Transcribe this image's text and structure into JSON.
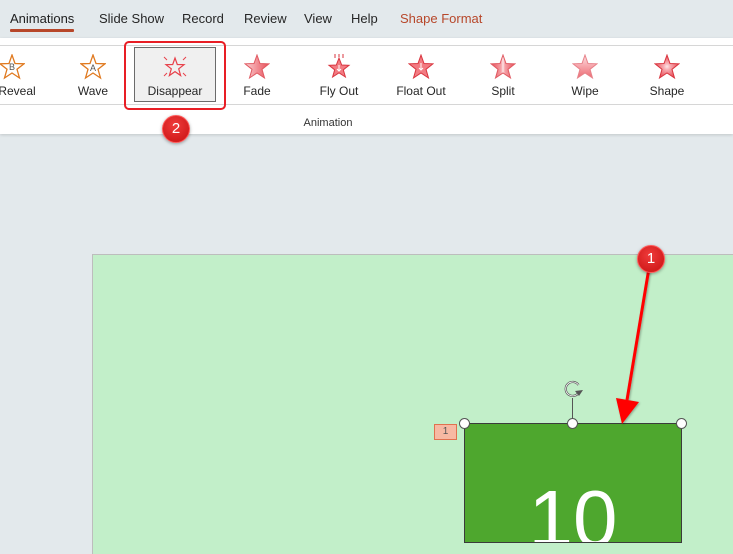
{
  "tabs": [
    {
      "label": "Animations",
      "active": true
    },
    {
      "label": "Slide Show"
    },
    {
      "label": "Record"
    },
    {
      "label": "Review"
    },
    {
      "label": "View"
    },
    {
      "label": "Help"
    },
    {
      "label": "Shape Format",
      "contextual": true
    }
  ],
  "ribbon": {
    "gallery": [
      {
        "label": "d Reveal",
        "icon": "star-b-outline-icon"
      },
      {
        "label": "Wave",
        "icon": "star-a-outline-icon"
      },
      {
        "label": "Disappear",
        "icon": "star-burst-outline-icon",
        "selected": true
      },
      {
        "label": "Fade",
        "icon": "star-fade-icon"
      },
      {
        "label": "Fly Out",
        "icon": "star-flyout-icon"
      },
      {
        "label": "Float Out",
        "icon": "star-floatout-icon"
      },
      {
        "label": "Split",
        "icon": "star-split-icon"
      },
      {
        "label": "Wipe",
        "icon": "star-wipe-icon"
      },
      {
        "label": "Shape",
        "icon": "star-shape-icon"
      }
    ],
    "group_label": "Animation"
  },
  "callouts": {
    "step1": "1",
    "step2": "2"
  },
  "slide": {
    "shape_text": "10",
    "animation_tag": "1"
  },
  "colors": {
    "accent": "#b7472a",
    "callout": "#e81e25",
    "slide_bg": "#c2efc9",
    "shape_fill": "#4ea72e"
  }
}
